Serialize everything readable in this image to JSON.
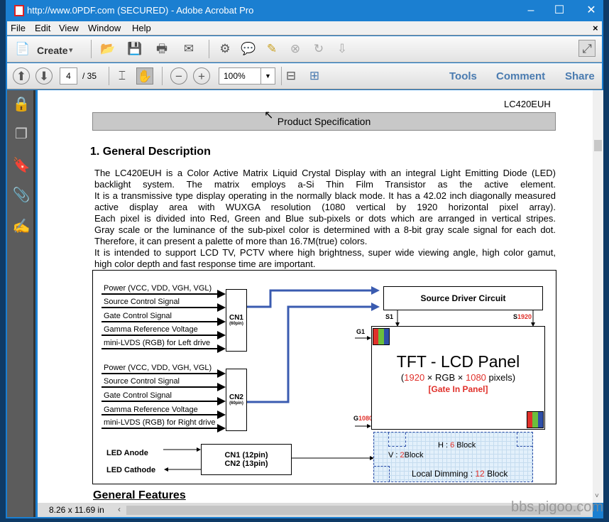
{
  "window": {
    "title": "http://www.0PDF.com (SECURED) - Adobe Acrobat Pro",
    "minimize": "–",
    "maximize": "☐",
    "close": "✕"
  },
  "menu": [
    "File",
    "Edit",
    "View",
    "Window",
    "Help"
  ],
  "menu_close": "×",
  "toolbar": {
    "create_label": "Create",
    "create_arrow": "▾"
  },
  "nav": {
    "page_current": "4",
    "page_total": "/ 35",
    "zoom": "100%",
    "tools": "Tools",
    "comment": "Comment",
    "share": "Share"
  },
  "status": {
    "page_size": "8.26 x 11.69 in"
  },
  "watermark": "bbs.pigoo.com",
  "document": {
    "model": "LC420EUH",
    "header_bar": "Product Specification",
    "section_title": "1. General Description",
    "paragraph": [
      "The LC420EUH is a Color Active Matrix Liquid Crystal Display with an integral Light Emitting Diode (LED)",
      "backlight system. The matrix employs a-Si Thin Film Transistor as the active element.",
      "It is a transmissive type display operating in the normally black mode. It has a 42.02 inch  diagonally measured",
      "active display area with WUXGA resolution (1080 vertical by 1920 horizontal pixel array).",
      "Each pixel is divided into Red, Green and Blue sub-pixels or dots which are arranged in vertical stripes.",
      "Gray scale or the luminance of the sub-pixel color is determined with a 8-bit gray scale signal for each dot.",
      "Therefore, it can present a palette of more than 16.7M(true) colors.",
      "It is intended to support LCD TV, PCTV where high brightness, super wide viewing angle, high color gamut,",
      "high color depth and fast response time are important."
    ],
    "diagram": {
      "cn1_signals": [
        "Power (VCC, VDD, VGH, VGL)",
        "Source Control Signal",
        "Gate Control Signal",
        "Gamma Reference Voltage",
        "mini-LVDS (RGB) for Left drive"
      ],
      "cn2_signals": [
        "Power (VCC, VDD, VGH, VGL)",
        "Source Control Signal",
        "Gate Control Signal",
        "Gamma Reference Voltage",
        "mini-LVDS (RGB) for Right drive"
      ],
      "cn1": "CN1",
      "cn1_pins": "(60pin)",
      "cn2": "CN2",
      "cn2_pins": "(60pin)",
      "source_driver": "Source Driver Circuit",
      "s1": "S1",
      "s_last_prefix": "S",
      "s_last": "1920",
      "g1": "G1",
      "g_last_prefix": "G",
      "g_last": "1080",
      "panel_title": "TFT - LCD Panel",
      "panel_res": {
        "open": "(",
        "h": "1920",
        "mid1": " × RGB × ",
        "v": "1080",
        "close": " pixels)"
      },
      "panel_note": "[Gate In Panel]",
      "led_anode": "LED Anode",
      "led_cathode": "LED Cathode",
      "led_cn1": "CN1 (12pin)",
      "led_cn2": "CN2 (13pin)",
      "dimming": {
        "h_label": "H : ",
        "h_value": "6",
        "h_unit": " Block",
        "v_label": "V : ",
        "v_value": "2",
        "v_unit": "Block",
        "total_label": "Local Dimming : ",
        "total_value": "12",
        "total_unit": " Block"
      },
      "colors": {
        "arrow_blue": "#3a5bb0",
        "red": "#e0302a",
        "green": "#6cbf3c",
        "blue": "#2f4fa8"
      }
    },
    "next_section": "General Features"
  }
}
